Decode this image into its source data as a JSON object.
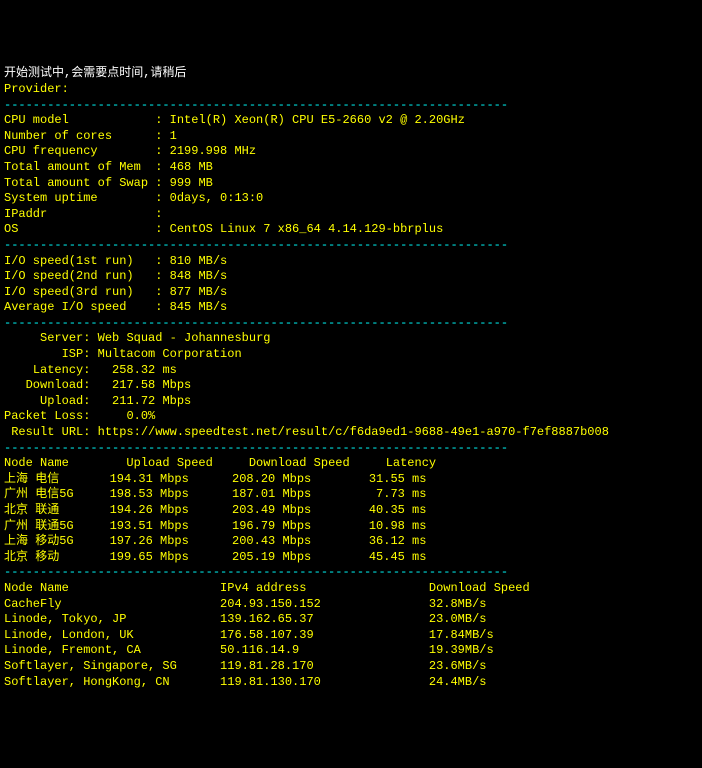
{
  "header": {
    "line1": "开始测试中,会需要点时间,请稍后",
    "line2": "Provider:"
  },
  "divider": "----------------------------------------------------------------------",
  "sys": {
    "cpu_model_k": "CPU model",
    "cpu_model_v": "Intel(R) Xeon(R) CPU E5-2660 v2 @ 2.20GHz",
    "cores_k": "Number of cores",
    "cores_v": "1",
    "freq_k": "CPU frequency",
    "freq_v": "2199.998 MHz",
    "mem_k": "Total amount of Mem",
    "mem_v": "468 MB",
    "swap_k": "Total amount of Swap",
    "swap_v": "999 MB",
    "uptime_k": "System uptime",
    "uptime_v": "0days, 0:13:0",
    "ipaddr_k": "IPaddr",
    "ipaddr_v": "",
    "os_k": "OS",
    "os_v": "CentOS Linux 7 x86_64 4.14.129-bbrplus"
  },
  "io": {
    "r1_k": "I/O speed(1st run)",
    "r1_v": "810 MB/s",
    "r2_k": "I/O speed(2nd run)",
    "r2_v": "848 MB/s",
    "r3_k": "I/O speed(3rd run)",
    "r3_v": "877 MB/s",
    "avg_k": "Average I/O speed",
    "avg_v": "845 MB/s"
  },
  "speedtest": {
    "server_k": "Server:",
    "server_v": "Web Squad - Johannesburg",
    "isp_k": "ISP:",
    "isp_v": "Multacom Corporation",
    "latency_k": "Latency:",
    "latency_v": "258.32 ms",
    "download_k": "Download:",
    "download_v": "217.58 Mbps",
    "upload_k": "Upload:",
    "upload_v": "211.72 Mbps",
    "loss_k": "Packet Loss:",
    "loss_v": "0.0%",
    "result_k": "Result URL:",
    "result_v": "https://www.speedtest.net/result/c/f6da9ed1-9688-49e1-a970-f7ef8887b008"
  },
  "nodes_header": {
    "c1": "Node Name",
    "c2": "Upload Speed",
    "c3": "Download Speed",
    "c4": "Latency"
  },
  "nodes": [
    {
      "n": "上海 电信",
      "u": "194.31 Mbps",
      "d": "208.20 Mbps",
      "l": "31.55 ms"
    },
    {
      "n": "广州 电信5G",
      "u": "198.53 Mbps",
      "d": "187.01 Mbps",
      "l": "7.73 ms"
    },
    {
      "n": "北京 联通",
      "u": "194.26 Mbps",
      "d": "203.49 Mbps",
      "l": "40.35 ms"
    },
    {
      "n": "广州 联通5G",
      "u": "193.51 Mbps",
      "d": "196.79 Mbps",
      "l": "10.98 ms"
    },
    {
      "n": "上海 移动5G",
      "u": "197.26 Mbps",
      "d": "200.43 Mbps",
      "l": "36.12 ms"
    },
    {
      "n": "北京 移动",
      "u": "199.65 Mbps",
      "d": "205.19 Mbps",
      "l": "45.45 ms"
    }
  ],
  "dl_header": {
    "c1": "Node Name",
    "c2": "IPv4 address",
    "c3": "Download Speed"
  },
  "dl": [
    {
      "n": "CacheFly",
      "ip": "204.93.150.152",
      "s": "32.8MB/s"
    },
    {
      "n": "Linode, Tokyo, JP",
      "ip": "139.162.65.37",
      "s": "23.0MB/s"
    },
    {
      "n": "Linode, London, UK",
      "ip": "176.58.107.39",
      "s": "17.84MB/s"
    },
    {
      "n": "Linode, Fremont, CA",
      "ip": "50.116.14.9",
      "s": "19.39MB/s"
    },
    {
      "n": "Softlayer, Singapore, SG",
      "ip": "119.81.28.170",
      "s": "23.6MB/s"
    },
    {
      "n": "Softlayer, HongKong, CN",
      "ip": "119.81.130.170",
      "s": "24.4MB/s"
    }
  ]
}
